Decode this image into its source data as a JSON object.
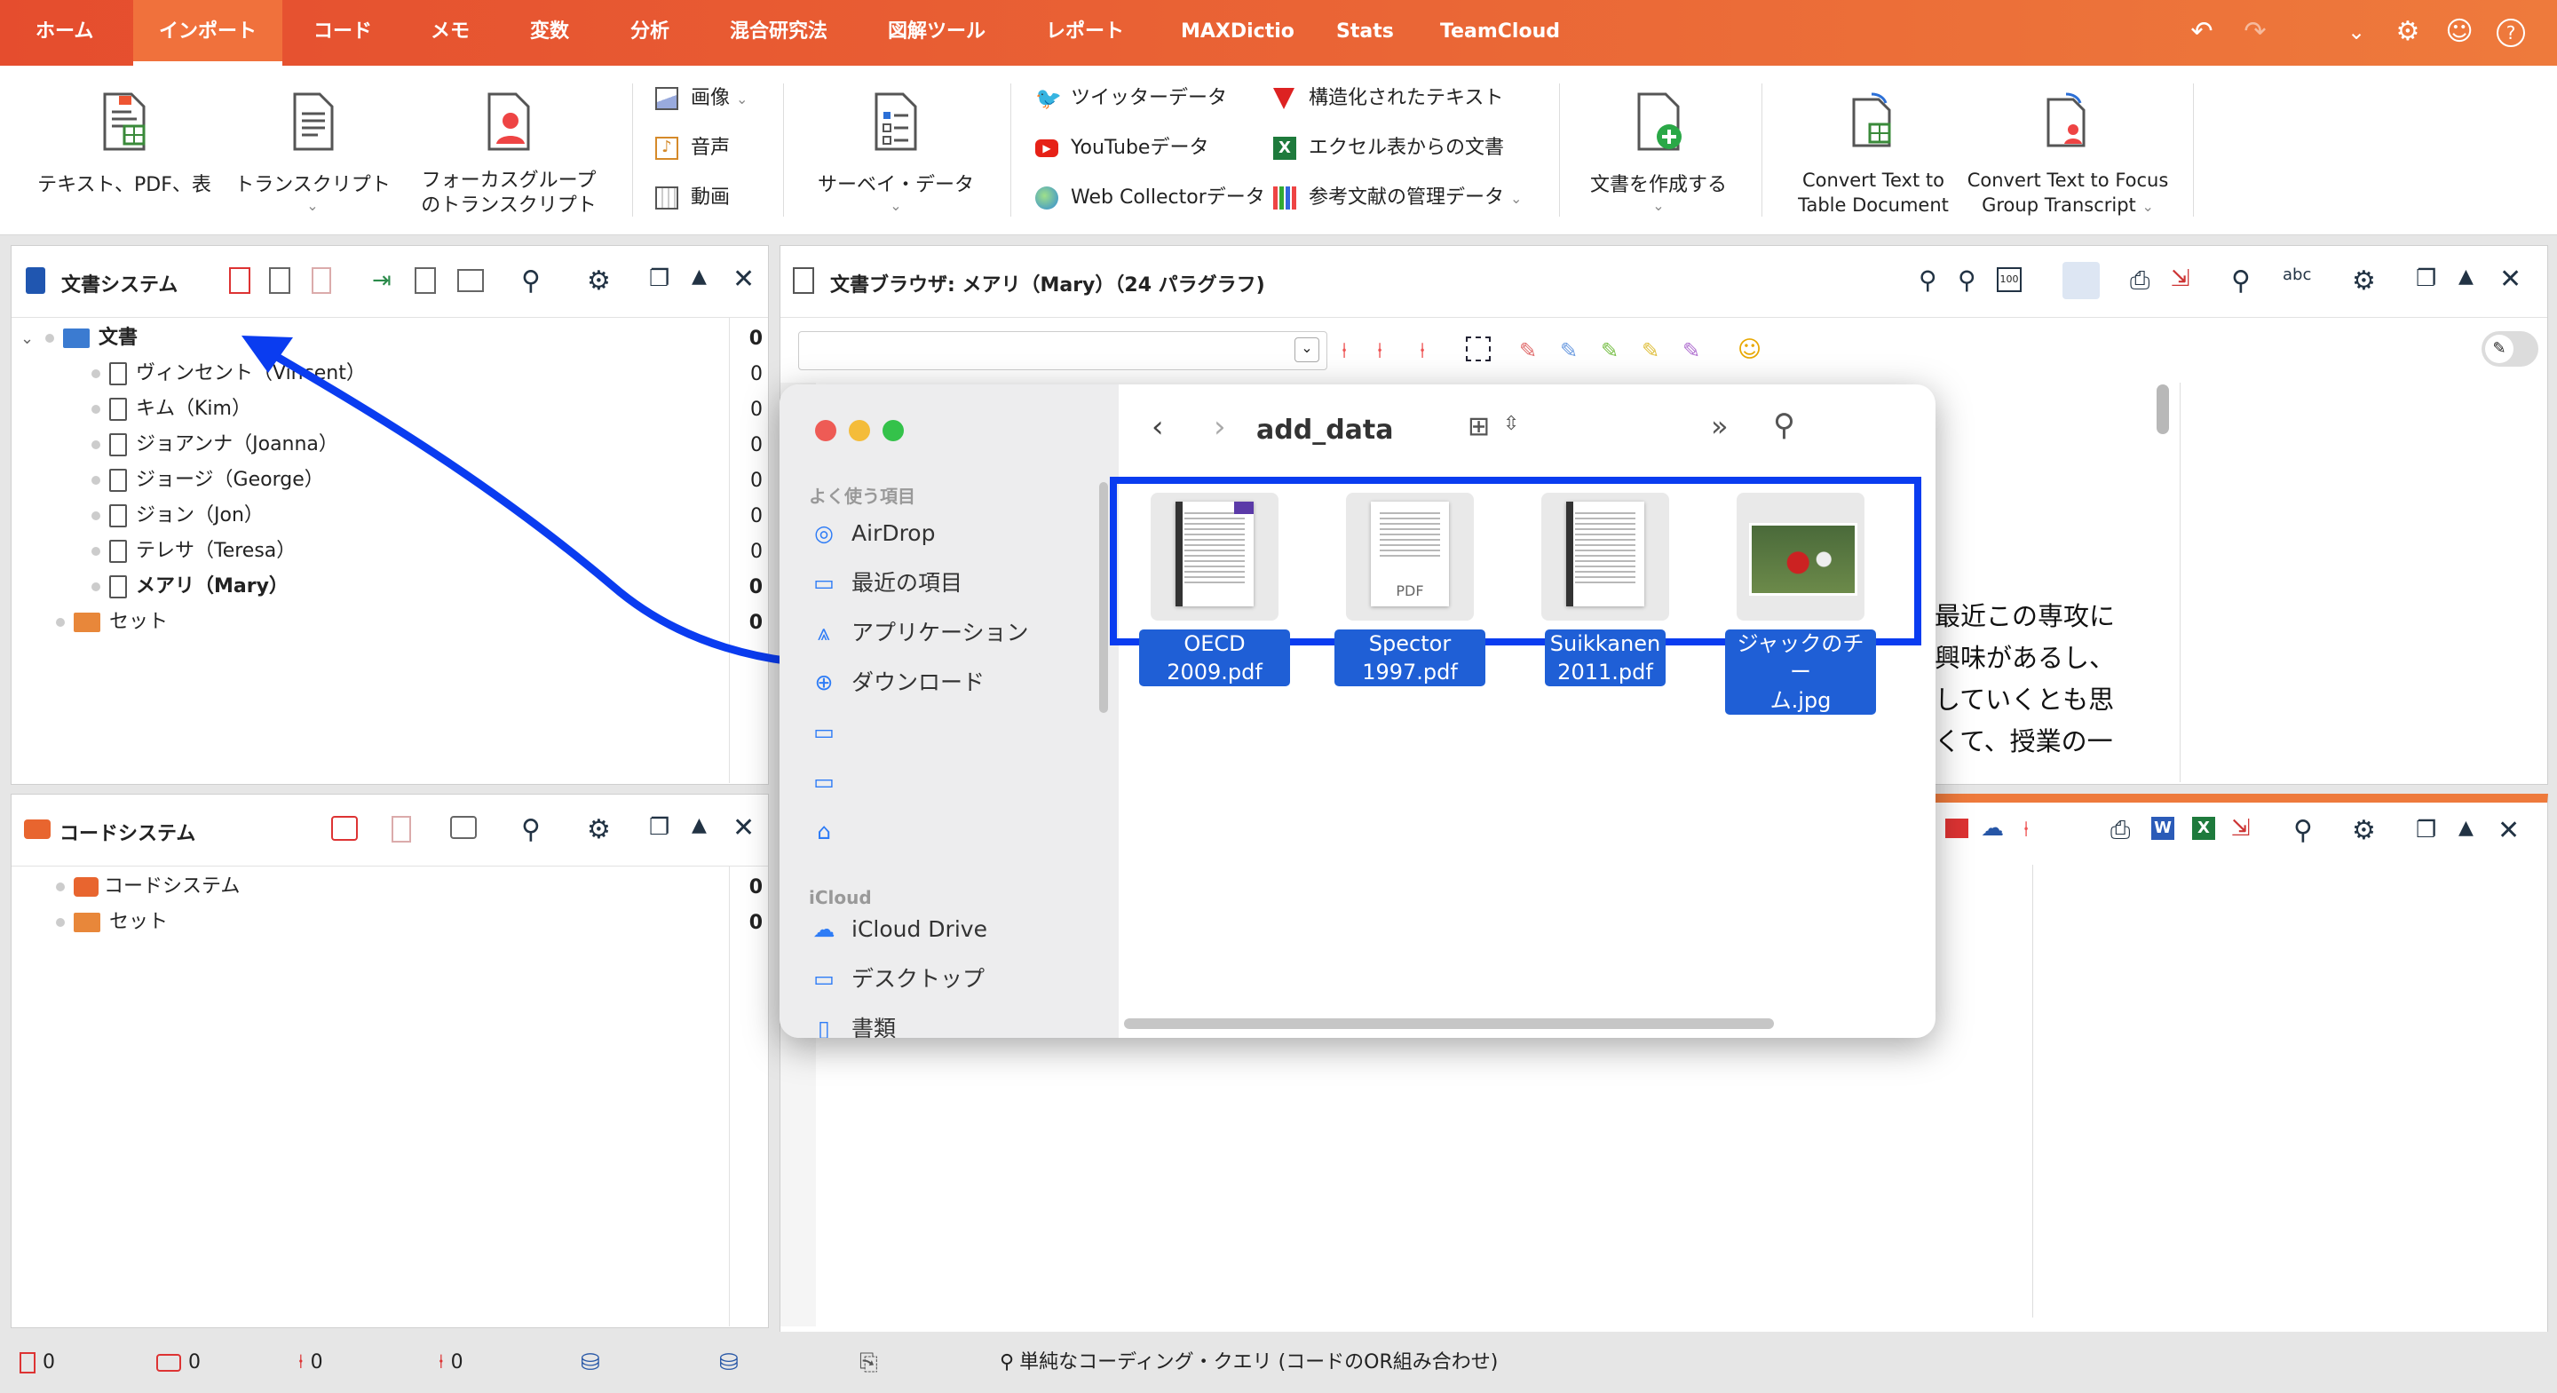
{
  "menu": {
    "tabs": [
      "ホーム",
      "インポート",
      "コード",
      "メモ",
      "変数",
      "分析",
      "混合研究法",
      "図解ツール",
      "レポート",
      "MAXDictio",
      "Stats",
      "TeamCloud"
    ],
    "active_index": 1
  },
  "ribbon": {
    "text_pdf": "テキスト、PDF、表",
    "transcript": "トランスクリプト",
    "focus_line1": "フォーカスグループ",
    "focus_line2": "のトランスクリプト",
    "image": "画像",
    "audio": "音声",
    "video": "動画",
    "survey": "サーベイ・データ",
    "twitter": "ツイッターデータ",
    "youtube": "YouTubeデータ",
    "webcollector": "Web Collectorデータ",
    "structured": "構造化されたテキスト",
    "excel": "エクセル表からの文書",
    "bib": "参考文献の管理データ",
    "create_doc": "文書を作成する",
    "convert_table_l1": "Convert Text to",
    "convert_table_l2": "Table Document",
    "convert_focus_l1": "Convert Text to Focus",
    "convert_focus_l2": "Group Transcript"
  },
  "doc_system": {
    "title": "文書システム",
    "root": {
      "label": "文書",
      "count": "0"
    },
    "items": [
      {
        "label": "ヴィンセント（Vincent）",
        "count": "0",
        "bold": false
      },
      {
        "label": "キム（Kim）",
        "count": "0",
        "bold": false
      },
      {
        "label": "ジョアンナ（Joanna）",
        "count": "0",
        "bold": false
      },
      {
        "label": "ジョージ（George）",
        "count": "0",
        "bold": false
      },
      {
        "label": "ジョン（Jon）",
        "count": "0",
        "bold": false
      },
      {
        "label": "テレサ（Teresa）",
        "count": "0",
        "bold": false
      },
      {
        "label": "メアリ（Mary）",
        "count": "0",
        "bold": true
      }
    ],
    "sets": {
      "label": "セット",
      "count": "0"
    }
  },
  "code_system": {
    "title": "コードシステム",
    "root": {
      "label": "コードシステム",
      "count": "0"
    },
    "sets": {
      "label": "セット",
      "count": "0"
    }
  },
  "doc_browser": {
    "title": "文書ブラウザ: メアリ（Mary）（24 パラグラフ)",
    "text_lines": [
      "最近この専攻に",
      "興味があるし、",
      "していくとも思",
      "くて、授業の一"
    ]
  },
  "finder": {
    "folder": "add_data",
    "favorites_header": "よく使う項目",
    "favorites": [
      {
        "label": "AirDrop",
        "icon": "airdrop-icon"
      },
      {
        "label": "最近の項目",
        "icon": "clock-icon"
      },
      {
        "label": "アプリケーション",
        "icon": "apps-icon"
      },
      {
        "label": "ダウンロード",
        "icon": "download-icon"
      },
      {
        "label": "",
        "icon": "folder-icon"
      },
      {
        "label": "",
        "icon": "folder-icon"
      },
      {
        "label": "",
        "icon": "home-icon"
      }
    ],
    "icloud_header": "iCloud",
    "icloud": [
      {
        "label": "iCloud Drive",
        "icon": "cloud-icon"
      },
      {
        "label": "デスクトップ",
        "icon": "desktop-icon"
      },
      {
        "label": "書類",
        "icon": "doc-icon"
      }
    ],
    "files": [
      {
        "line1": "OECD 2009.pdf",
        "line2": ""
      },
      {
        "line1": "Spector 1997.pdf",
        "line2": ""
      },
      {
        "line1": "Suikkanen",
        "line2": "2011.pdf"
      },
      {
        "line1": "ジャックのチー",
        "line2": "ム.jpg"
      }
    ],
    "pdf_label": "PDF"
  },
  "statusbar": {
    "counts": [
      "0",
      "0",
      "0",
      "0"
    ],
    "query": "単純なコーディング・クエリ (コードのOR組み合わせ)"
  },
  "colors": {
    "accent_orange": "#e8572f",
    "selection_blue": "#1f5fd6",
    "annotation_blue": "#0a3cf0"
  }
}
